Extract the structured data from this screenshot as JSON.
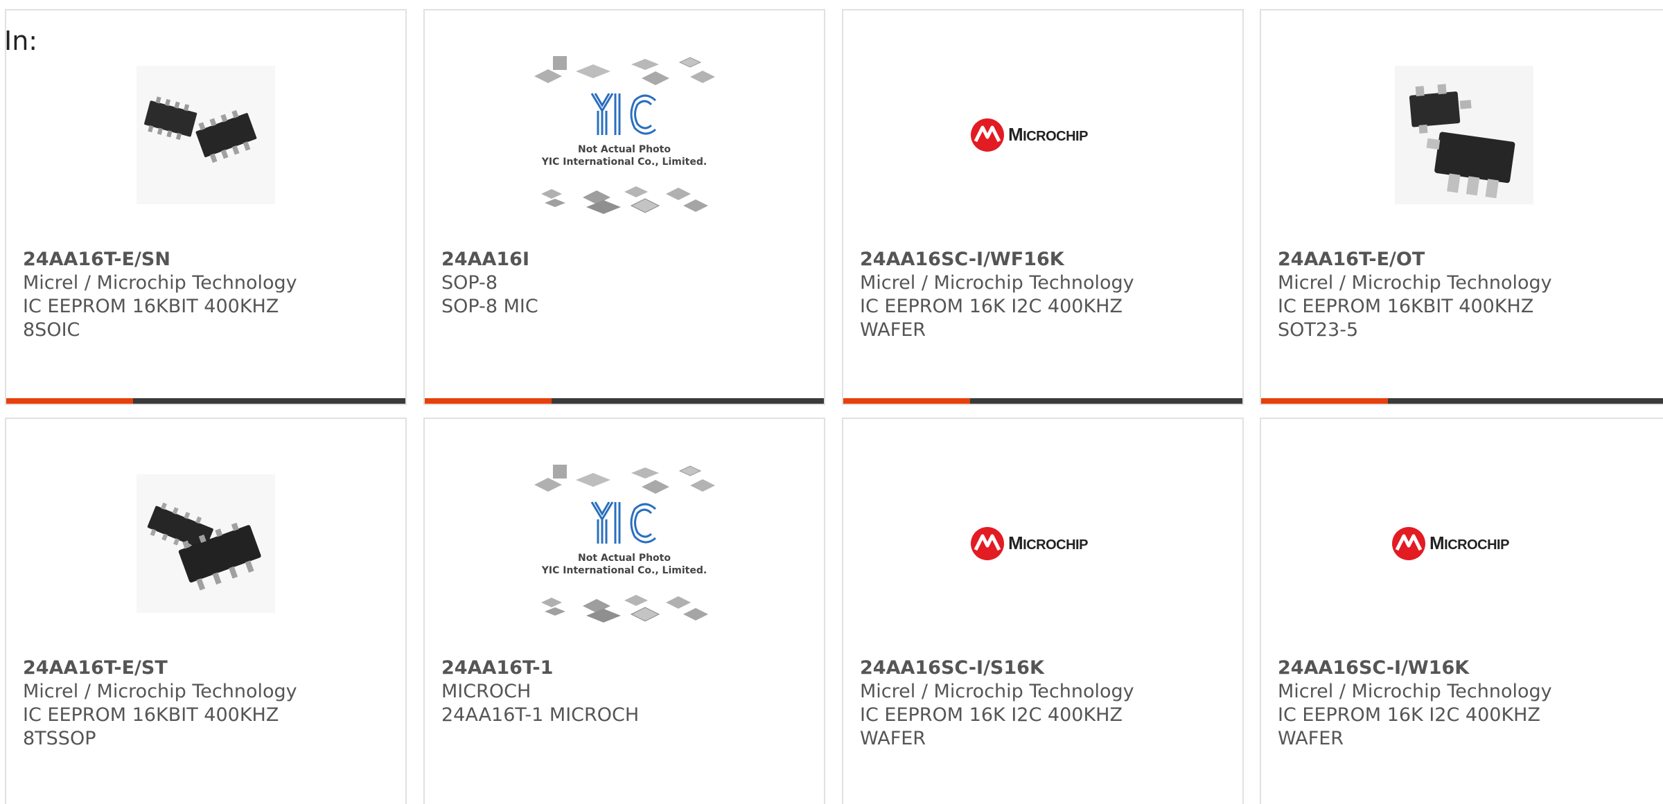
{
  "header": {
    "label": "In:"
  },
  "accent_color": "#e8400c",
  "bar_color": "#3a3a3a",
  "products": [
    {
      "part_number": "24AA16T-E/SN",
      "line1": "Micrel / Microchip Technology",
      "line2": "IC EEPROM 16KBIT 400KHZ",
      "line3": "8SOIC",
      "image": "soic8-chip-photo"
    },
    {
      "part_number": "24AA16I",
      "line1": "SOP-8",
      "line2": "SOP-8 MIC",
      "line3": "",
      "image": "yic-not-actual-photo",
      "image_text_1": "Not Actual Photo",
      "image_text_2": "YIC International Co., Limited."
    },
    {
      "part_number": "24AA16SC-I/WF16K",
      "line1": "Micrel / Microchip Technology",
      "line2": "IC EEPROM 16K I2C 400KHZ",
      "line3": "WAFER",
      "image": "microchip-logo"
    },
    {
      "part_number": "24AA16T-E/OT",
      "line1": "Micrel / Microchip Technology",
      "line2": "IC EEPROM 16KBIT 400KHZ",
      "line3": "SOT23-5",
      "image": "sot23-chip-photo"
    },
    {
      "part_number": "24AA16T-E/ST",
      "line1": "Micrel / Microchip Technology",
      "line2": "IC EEPROM 16KBIT 400KHZ",
      "line3": "8TSSOP",
      "image": "tssop8-chip-photo"
    },
    {
      "part_number": "24AA16T-1",
      "line1": "MICROCH",
      "line2": "24AA16T-1 MICROCH",
      "line3": "",
      "image": "yic-not-actual-photo",
      "image_text_1": "Not Actual Photo",
      "image_text_2": "YIC International Co., Limited."
    },
    {
      "part_number": "24AA16SC-I/S16K",
      "line1": "Micrel / Microchip Technology",
      "line2": "IC EEPROM 16K I2C 400KHZ",
      "line3": "WAFER",
      "image": "microchip-logo"
    },
    {
      "part_number": "24AA16SC-I/W16K",
      "line1": "Micrel / Microchip Technology",
      "line2": "IC EEPROM 16K I2C 400KHZ",
      "line3": "WAFER",
      "image": "microchip-logo"
    }
  ]
}
